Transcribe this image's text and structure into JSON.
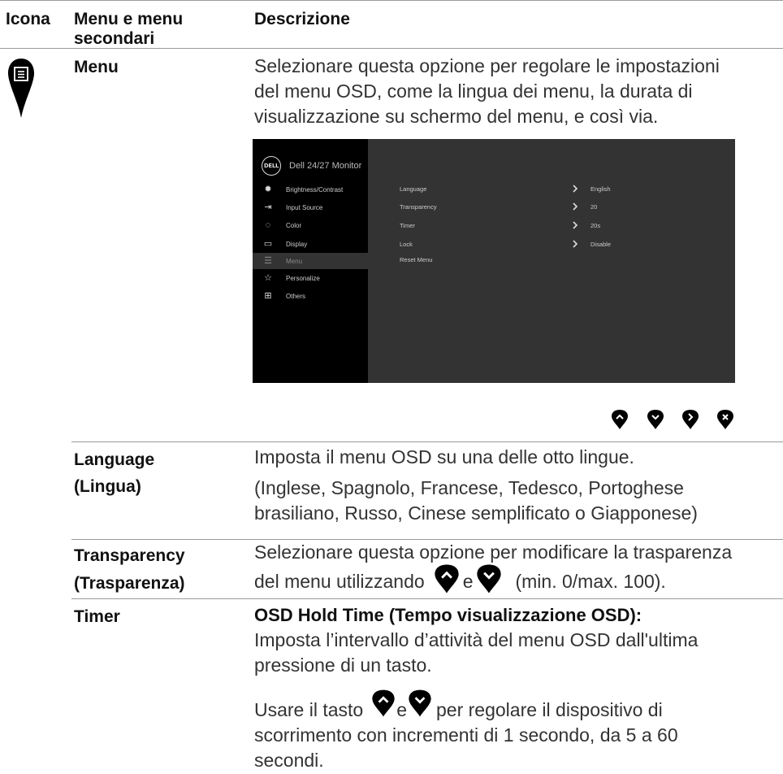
{
  "header": {
    "col1": "Icona",
    "col2_line1": "Menu e menu",
    "col2_line2": "secondari",
    "col3": "Descrizione"
  },
  "menu_row": {
    "icon_name": "menu-icon",
    "label": "Menu",
    "desc_lines": [
      "Selezionare questa opzione per regolare le impostazioni",
      "del menu OSD, come la lingua dei menu, la durata di",
      "visualizzazione su schermo del menu, e così via."
    ]
  },
  "osd": {
    "title": "Dell 24/27 Monitor",
    "logo": "DELL",
    "items": [
      {
        "icon": "brightness-icon",
        "label": "Brightness/Contrast"
      },
      {
        "icon": "input-source-icon",
        "label": "Input Source"
      },
      {
        "icon": "color-icon",
        "label": "Color"
      },
      {
        "icon": "display-icon",
        "label": "Display"
      },
      {
        "icon": "menu-icon",
        "label": "Menu"
      },
      {
        "icon": "star-icon",
        "label": "Personalize"
      },
      {
        "icon": "others-icon",
        "label": "Others"
      }
    ],
    "rows": [
      {
        "label": "Language",
        "value": "English"
      },
      {
        "label": "Transparency",
        "value": "20"
      },
      {
        "label": "Timer",
        "value": "20s"
      },
      {
        "label": "Lock",
        "value": "Disable"
      },
      {
        "label": "Reset Menu",
        "value": ""
      }
    ]
  },
  "nav_buttons": [
    "up-button",
    "down-button",
    "right-button",
    "close-button"
  ],
  "language": {
    "label_line1": "Language",
    "label_line2": "(Lingua)",
    "desc1": "Imposta il menu OSD su una delle otto lingue.",
    "desc2_line1": "(Inglese, Spagnolo, Francese, Tedesco, Portoghese",
    "desc2_line2": "brasiliano, Russo, Cinese semplificato o Giapponese)"
  },
  "transparency": {
    "label_line1": "Transparency",
    "label_line2": "(Trasparenza)",
    "desc_line1": "Selezionare questa opzione per modificare la trasparenza",
    "desc_pre": "del menu utilizzando",
    "desc_mid": "e",
    "desc_post": "(min. 0/max. 100)."
  },
  "timer": {
    "label": "Timer",
    "heading": "OSD Hold Time (Tempo visualizzazione OSD):",
    "desc_line1": "Imposta l’intervallo d’attività del menu OSD dall'ultima",
    "desc_line2": "pressione di un tasto.",
    "use_pre": "Usare il tasto",
    "use_mid": "e",
    "use_post": "per regolare il dispositivo di",
    "use_line2": "scorrimento con incrementi di 1 secondo, da 5 a 60",
    "use_line3": "secondi."
  }
}
